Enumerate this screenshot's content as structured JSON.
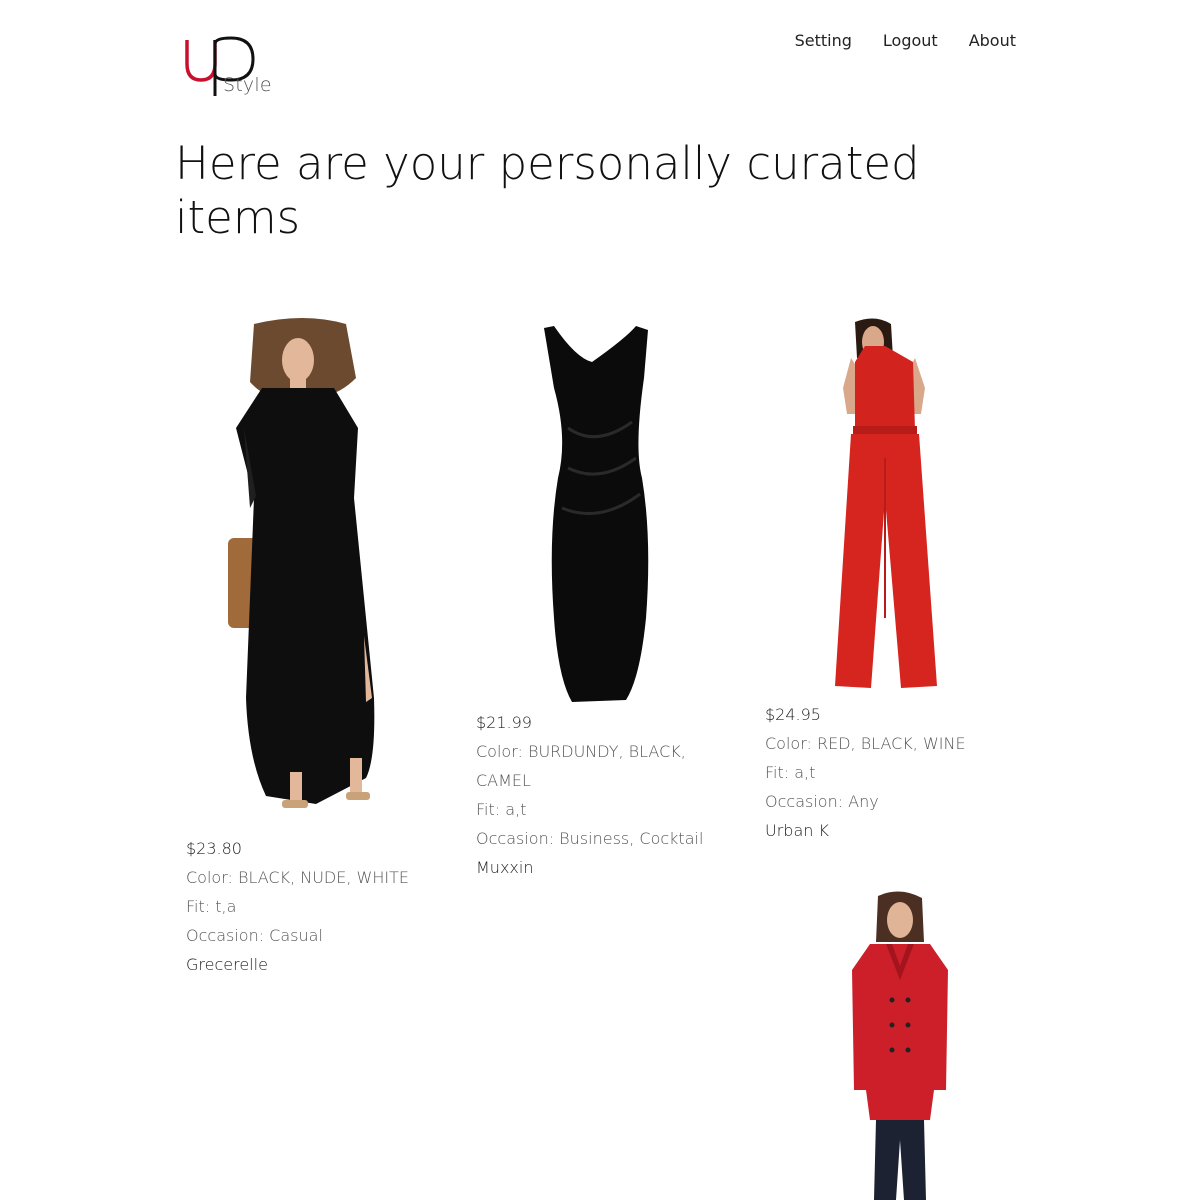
{
  "logo": {
    "mark": "up",
    "word": "Style"
  },
  "nav": {
    "items": [
      "Setting",
      "Logout",
      "About"
    ]
  },
  "page_title": "Here are your personally curated items",
  "products": [
    {
      "price": "$23.80",
      "color": "Color: BLACK, NUDE, WHITE",
      "fit": "Fit: t,a",
      "occasion": "Occasion: Casual",
      "brand": "Grecerelle",
      "image": "black-maxi-dress"
    },
    {
      "price": "$21.99",
      "color_line1": "Color: BURDUNDY, BLACK,",
      "color_line2": "CAMEL",
      "fit": "Fit: a,t",
      "occasion": "Occasion: Business, Cocktail",
      "brand": "Muxxin",
      "image": "black-sheath-dress"
    },
    {
      "price": "$24.95",
      "color": "Color: RED, BLACK, WINE",
      "fit": "Fit: a,t",
      "occasion": "Occasion: Any",
      "brand": "Urban K",
      "image": "red-halter-jumpsuit"
    },
    {
      "image": "red-wool-coat"
    }
  ],
  "colors": {
    "accent_red": "#c8102e",
    "text": "#222222",
    "muted": "#555555"
  }
}
